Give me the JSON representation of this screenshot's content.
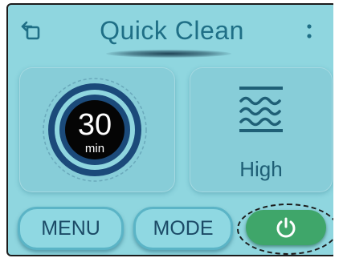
{
  "header": {
    "title": "Quick Clean",
    "back_icon": "rotate-back-icon",
    "more_icon": "more-vertical-icon"
  },
  "timer": {
    "value": "30",
    "unit": "min"
  },
  "suction": {
    "level": "High",
    "icon": "waves-icon"
  },
  "buttons": {
    "menu": "MENU",
    "mode": "MODE",
    "power_icon": "power-icon"
  },
  "colors": {
    "background": "#8fd6df",
    "accent": "#1f6f86",
    "power_button": "#3fa66a",
    "dial_ring": "#1b4a7a"
  }
}
